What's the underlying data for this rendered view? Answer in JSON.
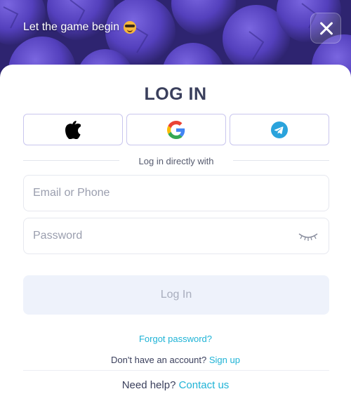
{
  "banner": {
    "text": "Let the game begin",
    "emoji_icon": "sunglasses-emoji-icon",
    "background_color": "#2e2470",
    "ball_color": "#5a48c6"
  },
  "close_icon": "close-icon",
  "login": {
    "title": "LOG IN",
    "social": [
      {
        "name": "apple",
        "icon": "apple-icon"
      },
      {
        "name": "google",
        "icon": "google-icon"
      },
      {
        "name": "telegram",
        "icon": "telegram-icon"
      }
    ],
    "divider_text": "Log in directly with",
    "email_placeholder": "Email or Phone",
    "password_placeholder": "Password",
    "password_toggle_icon": "eye-closed-icon",
    "submit_label": "Log In",
    "forgot_password": "Forgot password?",
    "no_account_text": "Don't have an account?",
    "signup_link": "Sign up",
    "help_text": "Need help?",
    "contact_link": "Contact us"
  },
  "colors": {
    "accent": "#1fb3d6",
    "title": "#3a3f5c",
    "button_disabled_bg": "#eef2fb",
    "social_border": "#c9c6ee"
  }
}
